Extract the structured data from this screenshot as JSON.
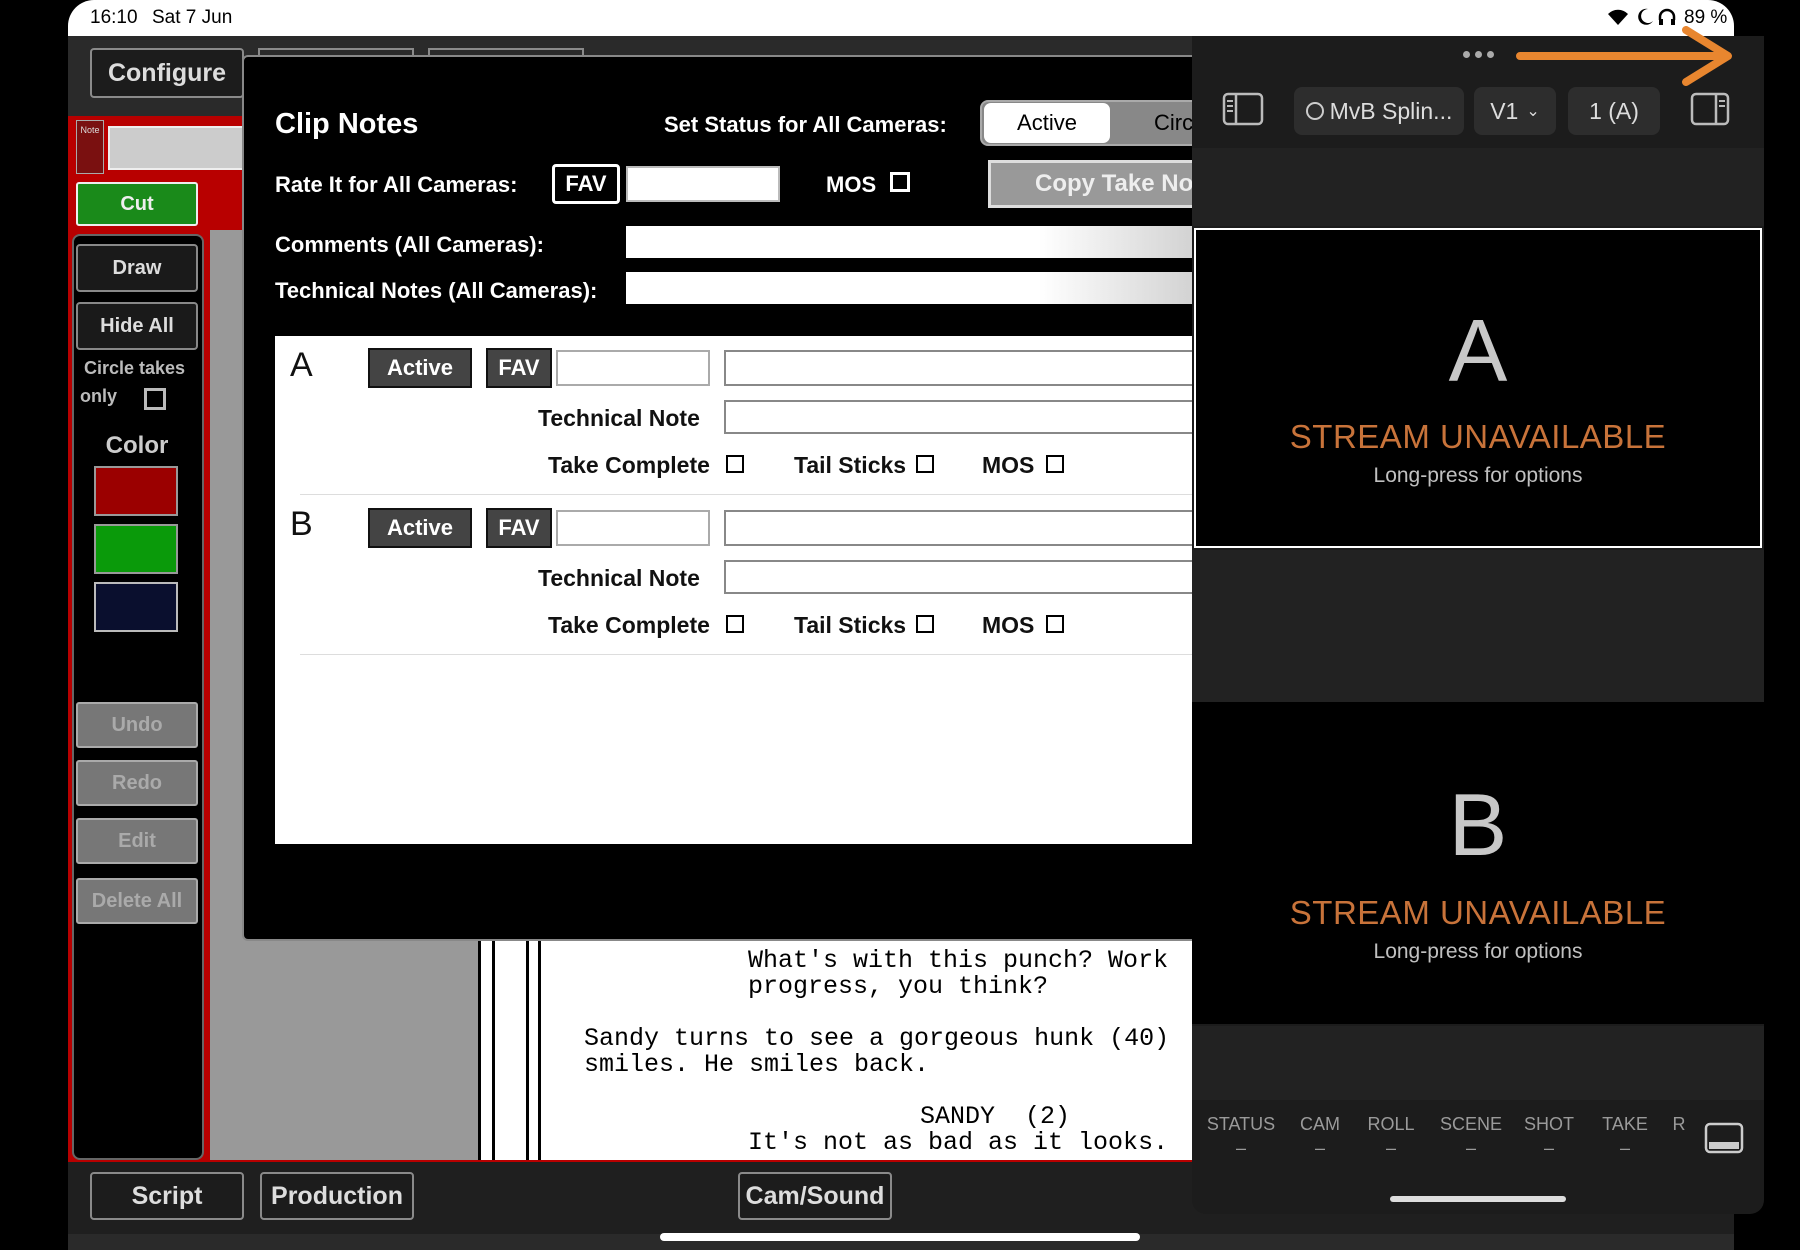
{
  "status_bar": {
    "time": "16:10",
    "date": "Sat 7 Jun",
    "battery": "89 %"
  },
  "top": {
    "configure": "Configure"
  },
  "sidebar": {
    "note_label": "Note",
    "cut": "Cut",
    "draw": "Draw",
    "hide_all": "Hide All",
    "circle_takes": "Circle takes",
    "only": "only",
    "color_label": "Color",
    "colors": [
      "#9b0000",
      "#0a9a0a",
      "#0a0f2e"
    ],
    "undo": "Undo",
    "redo": "Redo",
    "edit": "Edit",
    "delete_all": "Delete All"
  },
  "script": {
    "line1": "What's with this punch? Work",
    "line2": "progress, you think?",
    "line3": "Sandy turns to see a gorgeous hunk (40)",
    "line4": "smiles. He smiles back.",
    "char": "SANDY  (2)",
    "line5": "It's not as bad as it looks."
  },
  "bottom": {
    "script": "Script",
    "production": "Production",
    "cam_sound": "Cam/Sound"
  },
  "clip_notes": {
    "title": "Clip Notes",
    "set_status_label": "Set Status for All Cameras:",
    "status_active": "Active",
    "status_circle": "Circ",
    "rate_label": "Rate It for All Cameras:",
    "fav": "FAV",
    "mos": "MOS",
    "copy_btn": "Copy Take No",
    "comments_label": "Comments (All Cameras):",
    "tech_label": "Technical Notes (All Cameras):",
    "cameras": [
      {
        "id": "A",
        "status": "Active",
        "fav": "FAV",
        "tech_note": "Technical Note",
        "take_complete": "Take Complete",
        "tail_sticks": "Tail Sticks",
        "mos": "MOS"
      },
      {
        "id": "B",
        "status": "Active",
        "fav": "FAV",
        "tech_note": "Technical Note",
        "take_complete": "Take Complete",
        "tail_sticks": "Tail Sticks",
        "mos": "MOS"
      }
    ]
  },
  "stream_panel": {
    "device": "MvB Splin...",
    "version": "V1",
    "channel": "1 (A)",
    "streams": [
      {
        "id": "A",
        "status": "STREAM UNAVAILABLE",
        "hint": "Long-press for options"
      },
      {
        "id": "B",
        "status": "STREAM UNAVAILABLE",
        "hint": "Long-press for options"
      }
    ],
    "footer_cols": [
      "STATUS",
      "CAM",
      "ROLL",
      "SCENE",
      "SHOT",
      "TAKE",
      "R"
    ],
    "footer_vals": [
      "–",
      "–",
      "–",
      "–",
      "–",
      "–"
    ],
    "accent": "#e8862f"
  }
}
